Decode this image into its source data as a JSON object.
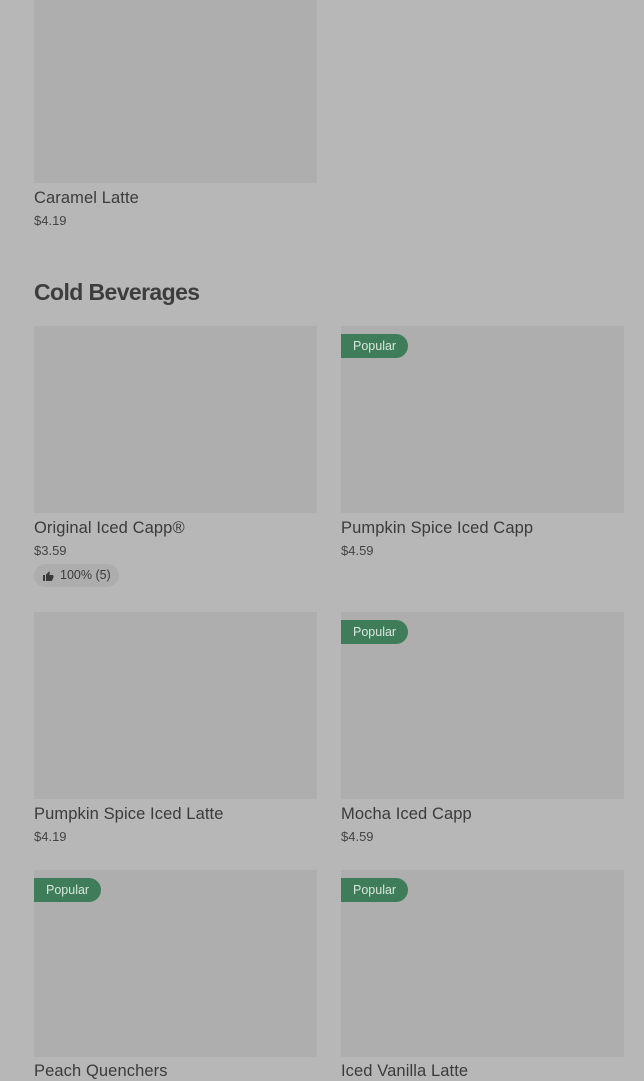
{
  "top_section": {
    "items": [
      {
        "name": "Caramel Latte",
        "price": "$4.19"
      }
    ]
  },
  "cold_beverages": {
    "title": "Cold Beverages",
    "items": [
      {
        "name": "Original Iced Capp®",
        "price": "$3.59",
        "rating": "100% (5)"
      },
      {
        "name": "Pumpkin Spice Iced Capp",
        "price": "$4.59",
        "badge": "Popular"
      },
      {
        "name": "Pumpkin Spice Iced Latte",
        "price": "$4.19"
      },
      {
        "name": "Mocha Iced Capp",
        "price": "$4.59",
        "badge": "Popular"
      },
      {
        "name": "Peach Quenchers",
        "badge": "Popular"
      },
      {
        "name": "Iced Vanilla Latte",
        "badge": "Popular"
      }
    ]
  },
  "icons": {
    "rating": "thumbs-up-icon"
  },
  "colors": {
    "background": "#b7b7b7",
    "image_placeholder": "#aeaeae",
    "badge": "#3f7d5a"
  }
}
